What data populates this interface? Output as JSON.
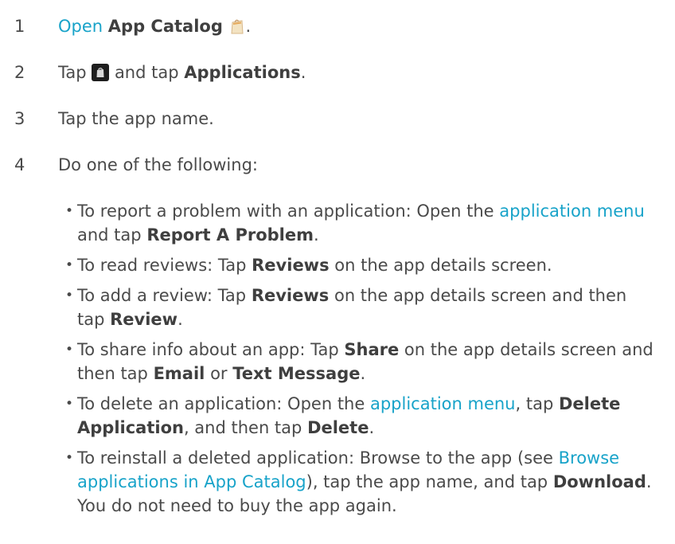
{
  "steps": [
    {
      "num": "1",
      "link": "Open",
      "bold": "App Catalog",
      "tail": "."
    },
    {
      "num": "2",
      "pre": "Tap",
      "mid": "and tap",
      "bold": "Applications",
      "tail": "."
    },
    {
      "num": "3",
      "text": "Tap the app name."
    },
    {
      "num": "4",
      "text": "Do one of the following:"
    }
  ],
  "bullets": [
    {
      "a": "To report a problem with an application: Open the",
      "link1": "application menu",
      "b": "and tap",
      "bold1": "Report A Problem",
      "c": "."
    },
    {
      "a": "To read reviews: Tap",
      "bold1": "Reviews",
      "b": "on the app details screen."
    },
    {
      "a": "To add a review: Tap",
      "bold1": "Reviews",
      "b": "on the app details screen and then tap",
      "bold2": "Review",
      "c": "."
    },
    {
      "a": "To share info about an app: Tap",
      "bold1": "Share",
      "b": "on the app details screen and then tap",
      "bold2": "Email",
      "c": "or",
      "bold3": "Text Message",
      "d": "."
    },
    {
      "a": "To delete an application: Open the",
      "link1": "application menu",
      "b": ", tap",
      "bold1": "Delete Application",
      "c": ", and then tap",
      "bold2": "Delete",
      "d": "."
    },
    {
      "a": "To reinstall a deleted application: Browse to the app (see",
      "link1": "Browse applications in App Catalog",
      "b": "), tap the app name, and tap",
      "bold1": "Download",
      "c": ". You do not need to buy the app again."
    }
  ],
  "bullet_char": "•",
  "icons": {
    "step1": "app-catalog-bag-icon",
    "step2": "app-catalog-menu-icon"
  },
  "colors": {
    "text": "#4a4a4a",
    "link": "#18a3c9"
  }
}
